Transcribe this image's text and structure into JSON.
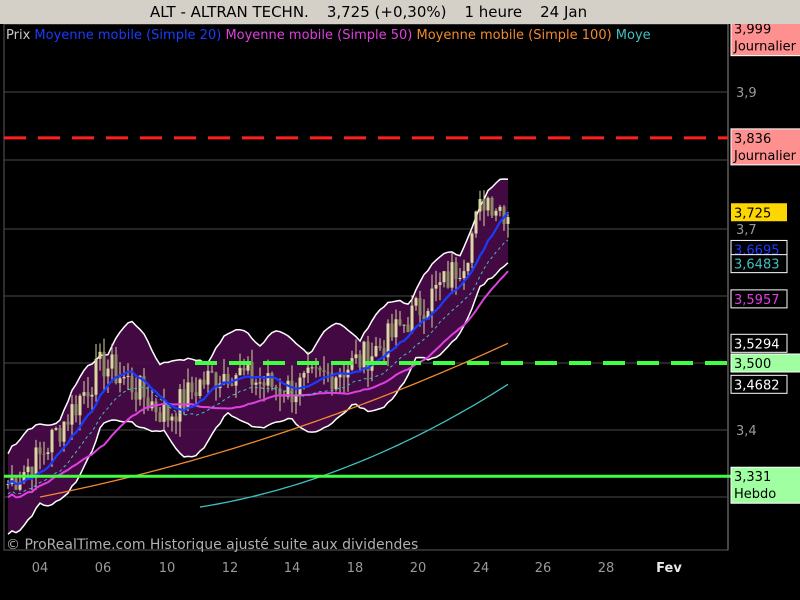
{
  "header": {
    "title": "ALT - ALTRAN TECHN.",
    "price": "3,725 (+0,30%)",
    "period": "1 heure",
    "date": "24 Jan"
  },
  "legend": [
    {
      "label": "Prix",
      "color": "#c8c8c8"
    },
    {
      "label": "Moyenne mobile (Simple 20)",
      "color": "#1a3cff"
    },
    {
      "label": "Moyenne mobile (Simple 50)",
      "color": "#e040e0"
    },
    {
      "label": "Moyenne mobile (Simple 100)",
      "color": "#f08a30"
    },
    {
      "label": "Moye",
      "color": "#40c0c0"
    }
  ],
  "watermark": "© ProRealTime.com Historique ajusté suite aux dividendes",
  "colors": {
    "background": "#000000",
    "candle": "#d8d8a0",
    "band_fill": "#4a0a4a",
    "band_line": "#ffffff",
    "sma20": "#1a3cff",
    "sma50": "#e040e0",
    "sma100": "#f08a30",
    "sma200": "#40c0c0",
    "red_level": "#ff2020",
    "green_level": "#40ff40"
  },
  "chart_data": {
    "type": "line",
    "ylim": [
      3.28,
      4.03
    ],
    "y_ticks": [
      "3,9",
      "3,7",
      "3,4"
    ],
    "x_tick_labels": [
      "04",
      "06",
      "10",
      "12",
      "14",
      "18",
      "20",
      "24",
      "26",
      "28",
      "Fev"
    ],
    "price_series": {
      "name": "Prix",
      "points": [
        [
          "03",
          3.32
        ],
        [
          "04",
          3.36
        ],
        [
          "05",
          3.43
        ],
        [
          "06",
          3.5
        ],
        [
          "07",
          3.47
        ],
        [
          "10",
          3.42
        ],
        [
          "11",
          3.47
        ],
        [
          "12",
          3.49
        ],
        [
          "13",
          3.47
        ],
        [
          "14",
          3.46
        ],
        [
          "17",
          3.48
        ],
        [
          "18",
          3.5
        ],
        [
          "19",
          3.53
        ],
        [
          "20",
          3.58
        ],
        [
          "21",
          3.62
        ],
        [
          "22",
          3.66
        ],
        [
          "23",
          3.75
        ],
        [
          "24",
          3.725
        ]
      ]
    },
    "sma20": {
      "name": "Moyenne mobile (Simple 20)",
      "end": 3.6695
    },
    "sma50": {
      "name": "Moyenne mobile (Simple 50)",
      "end": 3.5957
    },
    "sma100": {
      "name": "Moyenne mobile (Simple 100)",
      "end": 3.5294
    },
    "sma200": {
      "name": "Moye",
      "end": 3.4682
    },
    "band_upper_end": 3.81,
    "band_lower_end": 3.52,
    "levels": [
      {
        "value": 3.999,
        "label": "3,999",
        "sublabel": "Journalier",
        "color": "#ff2020",
        "style": "none"
      },
      {
        "value": 3.836,
        "label": "3,836",
        "sublabel": "Journalier",
        "color": "#ff2020",
        "style": "dashed"
      },
      {
        "value": 3.5,
        "label": "3,500",
        "sublabel": "",
        "color": "#40ff40",
        "style": "dashed"
      },
      {
        "value": 3.331,
        "label": "3,331",
        "sublabel": "Hebdo",
        "color": "#40ff40",
        "style": "solid"
      }
    ],
    "value_labels": [
      {
        "value": 3.725,
        "label": "3,725",
        "bg": "#ffd700",
        "fg": "#000000"
      },
      {
        "value": 3.6695,
        "label": "3,6695",
        "bg": "#000000",
        "fg": "#1a3cff",
        "border": "#ffffff"
      },
      {
        "value": 3.6483,
        "label": "3,6483",
        "bg": "#000000",
        "fg": "#40c0c0",
        "border": "#ffffff"
      },
      {
        "value": 3.5957,
        "label": "3,5957",
        "bg": "#000000",
        "fg": "#e040e0",
        "border": "#ffffff"
      },
      {
        "value": 3.5294,
        "label": "3,5294",
        "bg": "#000000",
        "fg": "#ffffff",
        "border": "#ffffff"
      },
      {
        "value": 3.4682,
        "label": "3,4682",
        "bg": "#000000",
        "fg": "#ffffff",
        "border": "#ffffff"
      }
    ]
  }
}
